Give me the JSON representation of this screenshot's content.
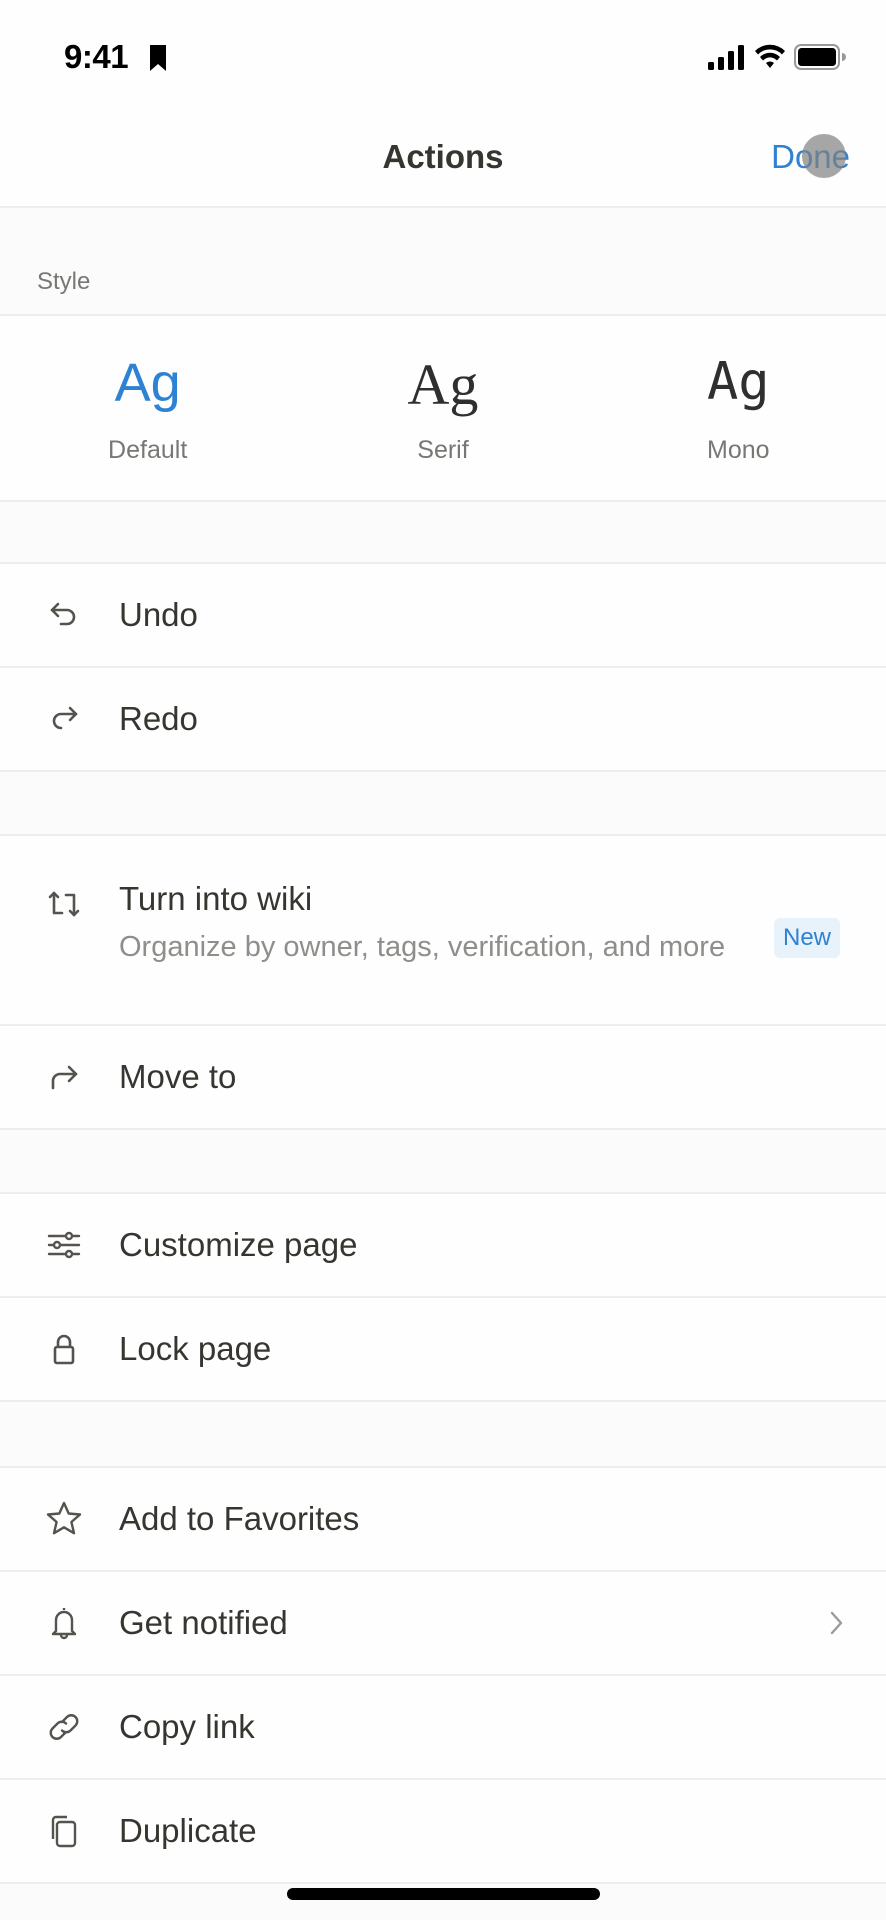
{
  "status_bar": {
    "time": "9:41",
    "icons": [
      "bookmark-icon",
      "cellular-signal-icon",
      "wifi-icon",
      "battery-icon"
    ]
  },
  "nav": {
    "title": "Actions",
    "done_label": "Done"
  },
  "style_section": {
    "header": "Style",
    "options": [
      {
        "sample": "Ag",
        "label": "Default",
        "selected": true
      },
      {
        "sample": "Ag",
        "label": "Serif",
        "selected": false
      },
      {
        "sample": "Ag",
        "label": "Mono",
        "selected": false
      }
    ]
  },
  "groups": [
    {
      "items": [
        {
          "label": "Undo",
          "icon": "undo-icon"
        },
        {
          "label": "Redo",
          "icon": "redo-icon"
        }
      ]
    },
    {
      "items": [
        {
          "label": "Turn into wiki",
          "icon": "turn-into-icon",
          "description": "Organize by owner, tags, verification, and more",
          "badge": "New"
        },
        {
          "label": "Move to",
          "icon": "move-to-icon"
        }
      ]
    },
    {
      "items": [
        {
          "label": "Customize page",
          "icon": "sliders-icon"
        },
        {
          "label": "Lock page",
          "icon": "lock-icon"
        }
      ]
    },
    {
      "items": [
        {
          "label": "Add to Favorites",
          "icon": "star-icon"
        },
        {
          "label": "Get notified",
          "icon": "bell-icon",
          "has_chevron": true
        },
        {
          "label": "Copy link",
          "icon": "link-icon"
        },
        {
          "label": "Duplicate",
          "icon": "duplicate-icon"
        }
      ]
    }
  ],
  "colors": {
    "accent": "#2e82d4",
    "badge_bg": "#e8f2fb",
    "text": "#37352f",
    "secondary_text": "#787774",
    "divider": "#ededeb",
    "background": "#fcfbfb"
  }
}
